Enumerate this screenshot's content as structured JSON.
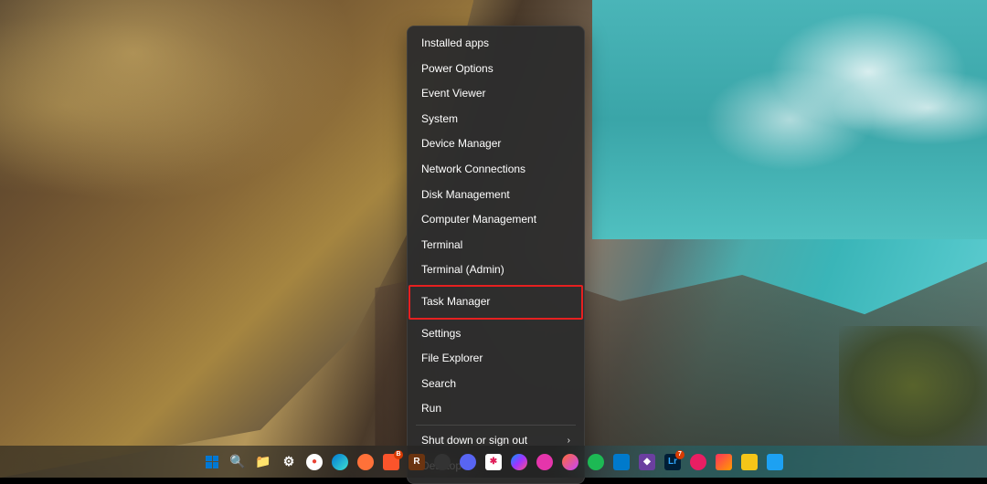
{
  "context_menu": {
    "groups": [
      {
        "items": [
          {
            "label": "Installed apps",
            "has_submenu": false
          },
          {
            "label": "Power Options",
            "has_submenu": false
          },
          {
            "label": "Event Viewer",
            "has_submenu": false
          },
          {
            "label": "System",
            "has_submenu": false
          },
          {
            "label": "Device Manager",
            "has_submenu": false
          },
          {
            "label": "Network Connections",
            "has_submenu": false
          },
          {
            "label": "Disk Management",
            "has_submenu": false
          },
          {
            "label": "Computer Management",
            "has_submenu": false
          },
          {
            "label": "Terminal",
            "has_submenu": false
          },
          {
            "label": "Terminal (Admin)",
            "has_submenu": false
          }
        ]
      },
      {
        "items": [
          {
            "label": "Task Manager",
            "has_submenu": false,
            "highlighted": true
          }
        ]
      },
      {
        "items": [
          {
            "label": "Settings",
            "has_submenu": false
          },
          {
            "label": "File Explorer",
            "has_submenu": false
          },
          {
            "label": "Search",
            "has_submenu": false
          },
          {
            "label": "Run",
            "has_submenu": false
          }
        ]
      },
      {
        "items": [
          {
            "label": "Shut down or sign out",
            "has_submenu": true
          },
          {
            "label": "Desktop",
            "has_submenu": false
          }
        ]
      }
    ]
  },
  "taskbar": {
    "items": [
      {
        "name": "start",
        "bg": "transparent",
        "glyph": "win"
      },
      {
        "name": "search",
        "bg": "transparent",
        "glyph": "🔍"
      },
      {
        "name": "file-explorer",
        "bg": "#ffb900",
        "glyph": "📁"
      },
      {
        "name": "settings",
        "bg": "transparent",
        "glyph": "⚙"
      },
      {
        "name": "chrome",
        "bg": "#fff",
        "glyph": "●",
        "color": "#ea4335",
        "round": true
      },
      {
        "name": "edge",
        "bg": "linear-gradient(135deg,#0078d4,#40e0d0)",
        "glyph": "",
        "round": true
      },
      {
        "name": "firefox",
        "bg": "#ff7139",
        "glyph": "",
        "round": true
      },
      {
        "name": "brave",
        "bg": "#fb542b",
        "glyph": "",
        "badge": "B"
      },
      {
        "name": "app-1",
        "bg": "#6b3410",
        "glyph": "R"
      },
      {
        "name": "app-2",
        "bg": "#333",
        "glyph": "",
        "round": true
      },
      {
        "name": "discord",
        "bg": "#5865f2",
        "glyph": "",
        "round": true
      },
      {
        "name": "slack",
        "bg": "#fff",
        "glyph": "✱",
        "color": "#e01e5a"
      },
      {
        "name": "messenger",
        "bg": "linear-gradient(135deg,#0099ff,#a033ff,#ff5280)",
        "glyph": "",
        "round": true
      },
      {
        "name": "app-3",
        "bg": "#e535ab",
        "glyph": "",
        "round": true
      },
      {
        "name": "app-4",
        "bg": "linear-gradient(135deg,#ff6b35,#c644fc)",
        "glyph": "",
        "round": true
      },
      {
        "name": "spotify",
        "bg": "#1db954",
        "glyph": "",
        "round": true
      },
      {
        "name": "vscode",
        "bg": "#007acc",
        "glyph": ""
      },
      {
        "name": "obsidian",
        "bg": "#6b3fa0",
        "glyph": "◆"
      },
      {
        "name": "lightroom",
        "bg": "#001e36",
        "glyph": "Lr",
        "color": "#31a8ff",
        "badge": "7"
      },
      {
        "name": "krita",
        "bg": "#e91e63",
        "glyph": "",
        "round": true
      },
      {
        "name": "jetbrains",
        "bg": "linear-gradient(135deg,#fe315d,#ff9c00)",
        "glyph": ""
      },
      {
        "name": "app-5",
        "bg": "#f5c518",
        "glyph": ""
      },
      {
        "name": "twitter",
        "bg": "#1da1f2",
        "glyph": ""
      }
    ]
  }
}
